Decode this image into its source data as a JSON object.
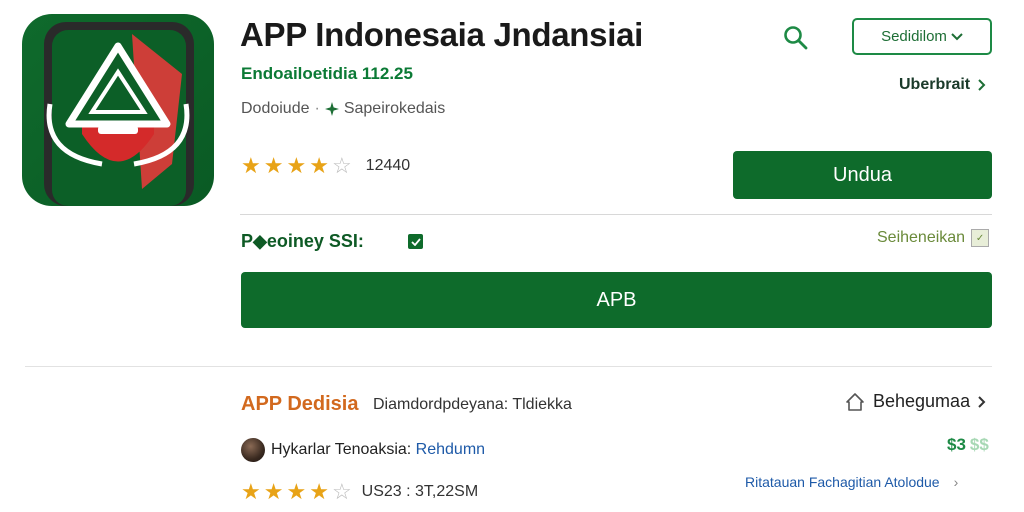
{
  "app": {
    "title": "APP Indonesaia Jndansiai",
    "developer": "Endoailoetidia 112.25",
    "category": "Dodoiude",
    "separator": "·",
    "tag": "Sapeirokedais",
    "rating": 3.5,
    "rating_count": "12440"
  },
  "header": {
    "select_label": "Sedidilom",
    "more_link": "Uberbrait"
  },
  "install_button": "Undua",
  "setting": {
    "label": "P◆eoiney SSI:",
    "link": "Seiheneikan"
  },
  "primary_button": "APB",
  "section": {
    "title": "APP Dedisia",
    "description": "Diamdordpdeyana: Tldiekka",
    "share": "Behegumaa"
  },
  "review": {
    "name": "Hykarlar Tenoaksia:",
    "link": "Rehdumn",
    "price": "$3",
    "price_faded": "$$",
    "rating": 3.5,
    "price_text": "US23 : 3T,22SM"
  },
  "footer_link": "Ritatauan Fachagitian Atolodue",
  "colors": {
    "brand_green": "#0e6b2b",
    "star": "#e8a317",
    "section_title": "#d2691e",
    "link_blue": "#1e5aa8"
  }
}
